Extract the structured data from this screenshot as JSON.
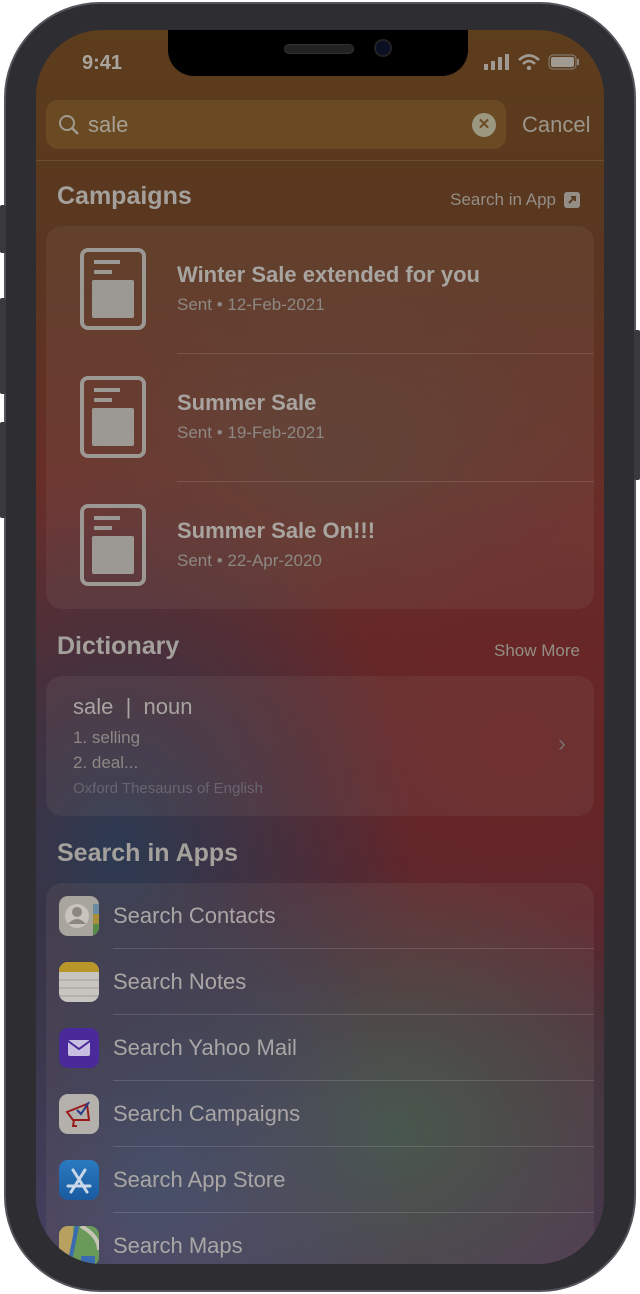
{
  "status": {
    "time": "9:41"
  },
  "search": {
    "query": "sale",
    "cancel": "Cancel"
  },
  "campaigns": {
    "title": "Campaigns",
    "link": "Search in App",
    "items": [
      {
        "title": "Winter Sale extended for you",
        "subtitle": "Sent • 12-Feb-2021"
      },
      {
        "title": "Summer Sale",
        "subtitle": "Sent • 19-Feb-2021"
      },
      {
        "title": "Summer Sale On!!!",
        "subtitle": "Sent • 22-Apr-2020"
      }
    ]
  },
  "dictionary": {
    "title": "Dictionary",
    "link": "Show More",
    "headword": "sale  |  noun",
    "def1": "1. selling",
    "def2": "2. deal...",
    "source": "Oxford Thesaurus of English"
  },
  "search_in_apps": {
    "title": "Search in Apps",
    "items": [
      {
        "label": "Search Contacts",
        "icon": "contacts-icon"
      },
      {
        "label": "Search Notes",
        "icon": "notes-icon"
      },
      {
        "label": "Search Yahoo Mail",
        "icon": "yahoo-mail-icon"
      },
      {
        "label": "Search Campaigns",
        "icon": "campaigns-icon"
      },
      {
        "label": "Search App Store",
        "icon": "app-store-icon"
      },
      {
        "label": "Search Maps",
        "icon": "maps-icon"
      }
    ]
  }
}
